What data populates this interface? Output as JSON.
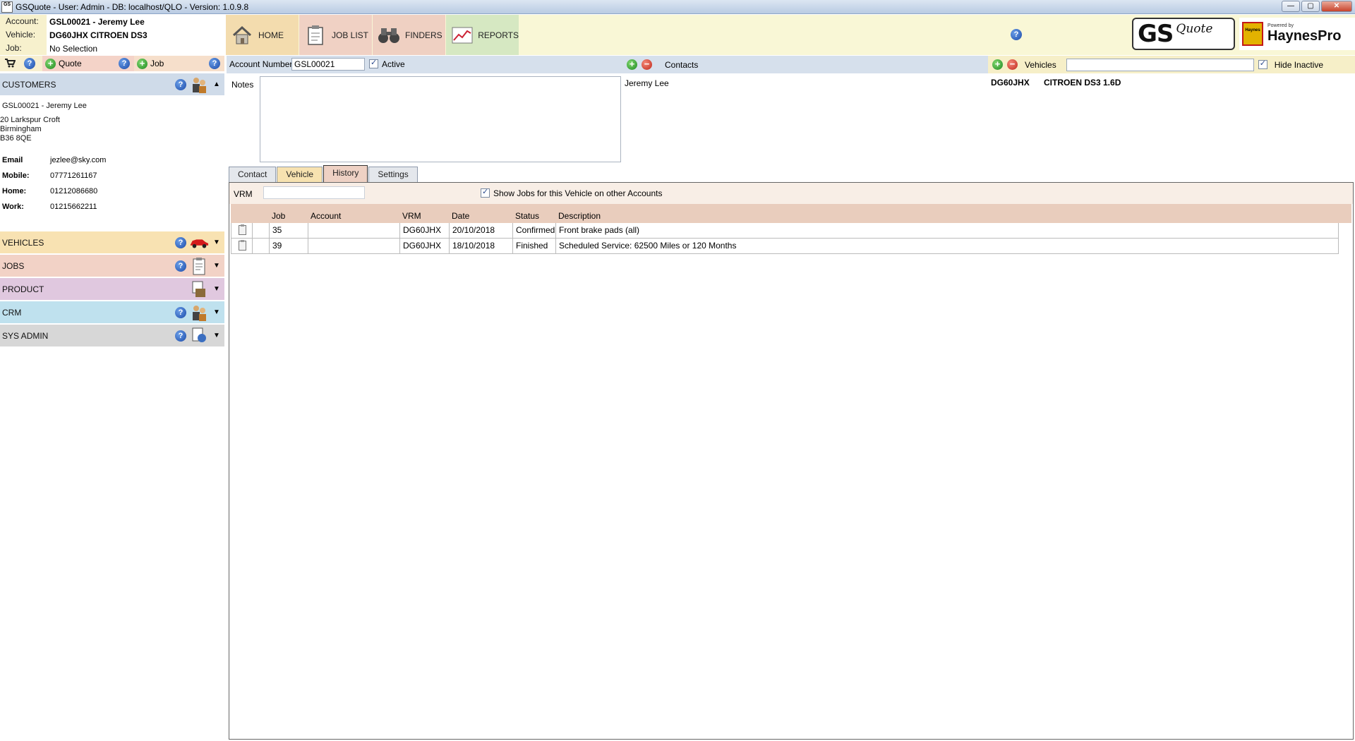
{
  "window": {
    "title": "GSQuote - User: Admin - DB: localhost/QLO - Version: 1.0.9.8",
    "app_icon_text": "GS"
  },
  "context": {
    "account_label": "Account:",
    "account_value": "GSL00021 - Jeremy Lee",
    "vehicle_label": "Vehicle:",
    "vehicle_value": "DG60JHX CITROEN DS3",
    "job_label": "Job:",
    "job_value": "No Selection"
  },
  "nav": {
    "home": "HOME",
    "job_list": "JOB LIST",
    "finders": "FINDERS",
    "reports": "REPORTS"
  },
  "logos": {
    "gs": "GS",
    "quote": "Quote",
    "haynes_badge": "Haynes",
    "powered_by": "Powered by",
    "haynespro": "HaynesPro"
  },
  "actions": {
    "quote_label": "Quote",
    "job_label": "Job"
  },
  "sections": {
    "customers": "CUSTOMERS",
    "vehicles": "VEHICLES",
    "jobs": "JOBS",
    "product": "PRODUCT",
    "crm": "CRM",
    "sys_admin": "SYS ADMIN"
  },
  "customer": {
    "name": "GSL00021 - Jeremy Lee",
    "address": [
      "20 Larkspur Croft",
      "Birmingham",
      "B36 8QE"
    ],
    "contacts": [
      {
        "label": "Email",
        "value": "jezlee@sky.com"
      },
      {
        "label": "Mobile:",
        "value": "07771261167"
      },
      {
        "label": "Home:",
        "value": "01212086680"
      },
      {
        "label": "Work:",
        "value": "01215662211"
      }
    ]
  },
  "account_bar": {
    "account_number_label": "Account Number",
    "account_number_value": "GSL00021",
    "active_label": "Active",
    "active_checked": true
  },
  "contacts_bar": {
    "label": "Contacts",
    "contact_name": "Jeremy Lee"
  },
  "vehicles_bar": {
    "label": "Vehicles",
    "hide_inactive_label": "Hide Inactive",
    "hide_inactive_checked": true,
    "reg": "DG60JHX",
    "description": "CITROEN DS3 1.6D"
  },
  "notes": {
    "label": "Notes",
    "value": ""
  },
  "tabs": [
    "Contact",
    "Vehicle",
    "History",
    "Settings"
  ],
  "active_tab": "History",
  "history": {
    "vrm_label": "VRM",
    "vrm_value": "",
    "show_jobs_label": "Show Jobs for this Vehicle on other Accounts",
    "show_jobs_checked": true,
    "columns": [
      "",
      "",
      "Job",
      "Account",
      "VRM",
      "Date",
      "Status",
      "Description"
    ],
    "rows": [
      {
        "job": "35",
        "account": "",
        "vrm": "DG60JHX",
        "date": "20/10/2018",
        "status": "Confirmed",
        "description": "Front brake pads (all)"
      },
      {
        "job": "39",
        "account": "",
        "vrm": "DG60JHX",
        "date": "18/10/2018",
        "status": "Finished",
        "description": "Scheduled Service: 62500 Miles or 120 Months"
      }
    ]
  },
  "colors": {
    "banner": "#f9f7d6",
    "customers_header": "#cfdbe9",
    "vehicles_header": "#f8e2b2",
    "jobs_header": "#f2d2c6",
    "product_header": "#e0c8df",
    "crm_header": "#bfe1ee",
    "sysadmin_header": "#d7d7d7",
    "help_icon": "#1b4aa8",
    "add_icon": "#1e8a22",
    "remove_icon": "#c0271a"
  }
}
